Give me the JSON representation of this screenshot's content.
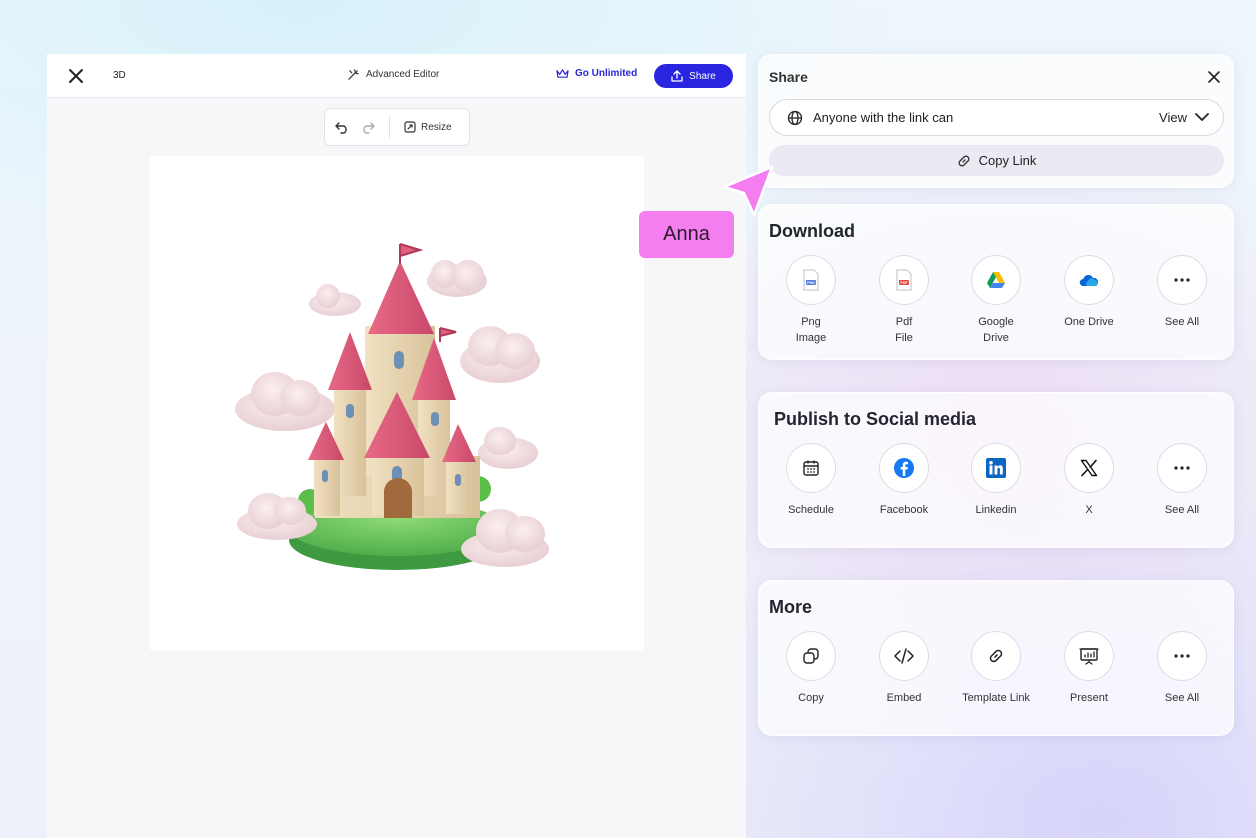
{
  "editor": {
    "mode_label": "3D",
    "advanced_editor": "Advanced Editor",
    "go_unlimited": "Go Unlimited",
    "share_button": "Share",
    "toolbar": {
      "resize": "Resize"
    }
  },
  "share_panel": {
    "title": "Share",
    "access_text": "Anyone with the link can",
    "access_value": "View",
    "copy_link": "Copy Link"
  },
  "download": {
    "title": "Download",
    "items": [
      {
        "label": "Png\nImage",
        "icon": "png-file-icon"
      },
      {
        "label": "Pdf\nFile",
        "icon": "pdf-file-icon"
      },
      {
        "label": "Google\nDrive",
        "icon": "google-drive-icon"
      },
      {
        "label": "One Drive",
        "icon": "one-drive-icon"
      },
      {
        "label": "See All",
        "icon": "more-icon"
      }
    ]
  },
  "social": {
    "title": "Publish to Social media",
    "items": [
      {
        "label": "Schedule",
        "icon": "calendar-icon"
      },
      {
        "label": "Facebook",
        "icon": "facebook-icon"
      },
      {
        "label": "Linkedin",
        "icon": "linkedin-icon"
      },
      {
        "label": "X",
        "icon": "x-icon"
      },
      {
        "label": "See All",
        "icon": "more-icon"
      }
    ]
  },
  "more": {
    "title": "More",
    "items": [
      {
        "label": "Copy",
        "icon": "copy-icon"
      },
      {
        "label": "Embed",
        "icon": "embed-code-icon"
      },
      {
        "label": "Template Link",
        "icon": "link-icon"
      },
      {
        "label": "Present",
        "icon": "present-icon"
      },
      {
        "label": "See All",
        "icon": "more-icon"
      }
    ]
  },
  "cursor": {
    "name": "Anna",
    "color": "#f47ef0"
  },
  "colors": {
    "accent": "#2a25e0",
    "cursor": "#f47ef0"
  }
}
